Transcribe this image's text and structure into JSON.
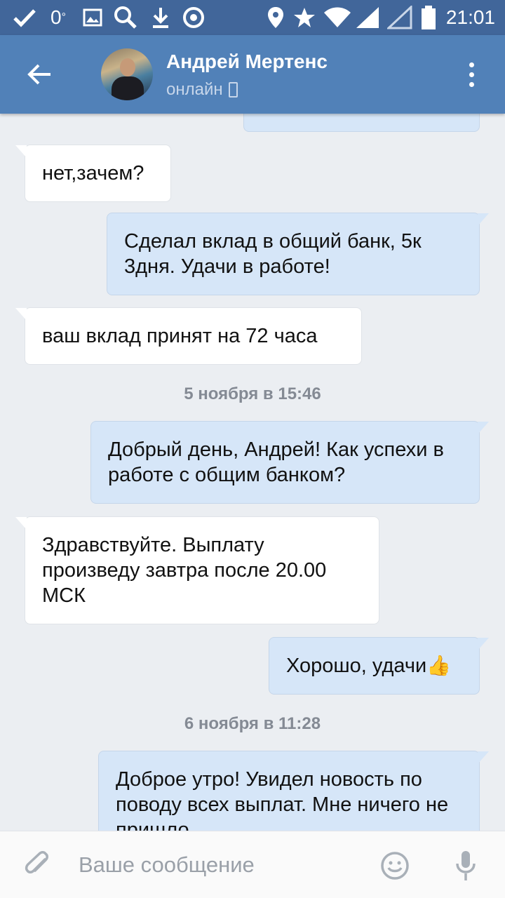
{
  "status_bar": {
    "signal_text": "0",
    "time": "21:01"
  },
  "header": {
    "contact_name": "Андрей Мертенс",
    "status": "онлайн"
  },
  "chat": {
    "messages": [
      {
        "direction": "out",
        "text": ""
      },
      {
        "direction": "in",
        "text": "нет,зачем?"
      },
      {
        "direction": "out",
        "text": "Сделал вклад в общий банк,  5к 3дня. Удачи в работе!"
      },
      {
        "direction": "in",
        "text": "ваш вклад принят на 72 часа"
      },
      {
        "direction": "out",
        "text": "Добрый день, Андрей! Как успехи в работе с общим банком?"
      },
      {
        "direction": "in",
        "text": "Здравствуйте. Выплату произведу завтра после 20.00 МСК"
      },
      {
        "direction": "out",
        "text": "Хорошо, удачи",
        "emoji": "👍"
      },
      {
        "direction": "out",
        "text": "Доброе утро! Увидел новость по поводу всех выплат. Мне ничего не пришло"
      }
    ],
    "date_separators": [
      "5 ноября в 15:46",
      "6 ноября в 11:28"
    ]
  },
  "input": {
    "placeholder": "Ваше сообщение"
  },
  "icons": {
    "back": "arrow-left-icon",
    "more": "more-vertical-icon",
    "attach": "paperclip-icon",
    "emoji": "smiley-icon",
    "mic": "microphone-icon"
  },
  "colors": {
    "header": "#5181b8",
    "status_bar": "#41669a",
    "background": "#ebeef2",
    "outgoing_bubble": "#d6e6f8",
    "incoming_bubble": "#ffffff"
  }
}
